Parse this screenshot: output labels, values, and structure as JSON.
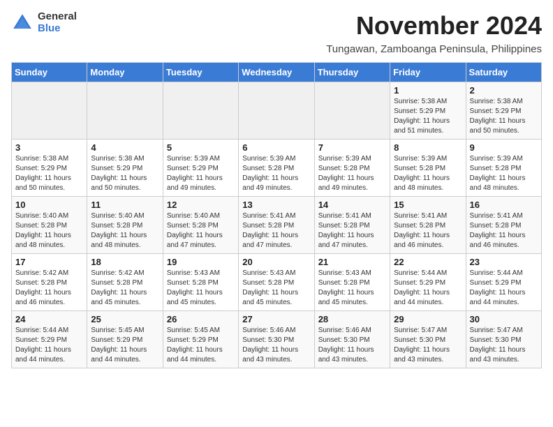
{
  "logo": {
    "general": "General",
    "blue": "Blue"
  },
  "title": "November 2024",
  "subtitle": "Tungawan, Zamboanga Peninsula, Philippines",
  "days_of_week": [
    "Sunday",
    "Monday",
    "Tuesday",
    "Wednesday",
    "Thursday",
    "Friday",
    "Saturday"
  ],
  "weeks": [
    [
      {
        "day": "",
        "info": ""
      },
      {
        "day": "",
        "info": ""
      },
      {
        "day": "",
        "info": ""
      },
      {
        "day": "",
        "info": ""
      },
      {
        "day": "",
        "info": ""
      },
      {
        "day": "1",
        "info": "Sunrise: 5:38 AM\nSunset: 5:29 PM\nDaylight: 11 hours and 51 minutes."
      },
      {
        "day": "2",
        "info": "Sunrise: 5:38 AM\nSunset: 5:29 PM\nDaylight: 11 hours and 50 minutes."
      }
    ],
    [
      {
        "day": "3",
        "info": "Sunrise: 5:38 AM\nSunset: 5:29 PM\nDaylight: 11 hours and 50 minutes."
      },
      {
        "day": "4",
        "info": "Sunrise: 5:38 AM\nSunset: 5:29 PM\nDaylight: 11 hours and 50 minutes."
      },
      {
        "day": "5",
        "info": "Sunrise: 5:39 AM\nSunset: 5:29 PM\nDaylight: 11 hours and 49 minutes."
      },
      {
        "day": "6",
        "info": "Sunrise: 5:39 AM\nSunset: 5:28 PM\nDaylight: 11 hours and 49 minutes."
      },
      {
        "day": "7",
        "info": "Sunrise: 5:39 AM\nSunset: 5:28 PM\nDaylight: 11 hours and 49 minutes."
      },
      {
        "day": "8",
        "info": "Sunrise: 5:39 AM\nSunset: 5:28 PM\nDaylight: 11 hours and 48 minutes."
      },
      {
        "day": "9",
        "info": "Sunrise: 5:39 AM\nSunset: 5:28 PM\nDaylight: 11 hours and 48 minutes."
      }
    ],
    [
      {
        "day": "10",
        "info": "Sunrise: 5:40 AM\nSunset: 5:28 PM\nDaylight: 11 hours and 48 minutes."
      },
      {
        "day": "11",
        "info": "Sunrise: 5:40 AM\nSunset: 5:28 PM\nDaylight: 11 hours and 48 minutes."
      },
      {
        "day": "12",
        "info": "Sunrise: 5:40 AM\nSunset: 5:28 PM\nDaylight: 11 hours and 47 minutes."
      },
      {
        "day": "13",
        "info": "Sunrise: 5:41 AM\nSunset: 5:28 PM\nDaylight: 11 hours and 47 minutes."
      },
      {
        "day": "14",
        "info": "Sunrise: 5:41 AM\nSunset: 5:28 PM\nDaylight: 11 hours and 47 minutes."
      },
      {
        "day": "15",
        "info": "Sunrise: 5:41 AM\nSunset: 5:28 PM\nDaylight: 11 hours and 46 minutes."
      },
      {
        "day": "16",
        "info": "Sunrise: 5:41 AM\nSunset: 5:28 PM\nDaylight: 11 hours and 46 minutes."
      }
    ],
    [
      {
        "day": "17",
        "info": "Sunrise: 5:42 AM\nSunset: 5:28 PM\nDaylight: 11 hours and 46 minutes."
      },
      {
        "day": "18",
        "info": "Sunrise: 5:42 AM\nSunset: 5:28 PM\nDaylight: 11 hours and 45 minutes."
      },
      {
        "day": "19",
        "info": "Sunrise: 5:43 AM\nSunset: 5:28 PM\nDaylight: 11 hours and 45 minutes."
      },
      {
        "day": "20",
        "info": "Sunrise: 5:43 AM\nSunset: 5:28 PM\nDaylight: 11 hours and 45 minutes."
      },
      {
        "day": "21",
        "info": "Sunrise: 5:43 AM\nSunset: 5:28 PM\nDaylight: 11 hours and 45 minutes."
      },
      {
        "day": "22",
        "info": "Sunrise: 5:44 AM\nSunset: 5:29 PM\nDaylight: 11 hours and 44 minutes."
      },
      {
        "day": "23",
        "info": "Sunrise: 5:44 AM\nSunset: 5:29 PM\nDaylight: 11 hours and 44 minutes."
      }
    ],
    [
      {
        "day": "24",
        "info": "Sunrise: 5:44 AM\nSunset: 5:29 PM\nDaylight: 11 hours and 44 minutes."
      },
      {
        "day": "25",
        "info": "Sunrise: 5:45 AM\nSunset: 5:29 PM\nDaylight: 11 hours and 44 minutes."
      },
      {
        "day": "26",
        "info": "Sunrise: 5:45 AM\nSunset: 5:29 PM\nDaylight: 11 hours and 44 minutes."
      },
      {
        "day": "27",
        "info": "Sunrise: 5:46 AM\nSunset: 5:30 PM\nDaylight: 11 hours and 43 minutes."
      },
      {
        "day": "28",
        "info": "Sunrise: 5:46 AM\nSunset: 5:30 PM\nDaylight: 11 hours and 43 minutes."
      },
      {
        "day": "29",
        "info": "Sunrise: 5:47 AM\nSunset: 5:30 PM\nDaylight: 11 hours and 43 minutes."
      },
      {
        "day": "30",
        "info": "Sunrise: 5:47 AM\nSunset: 5:30 PM\nDaylight: 11 hours and 43 minutes."
      }
    ]
  ]
}
